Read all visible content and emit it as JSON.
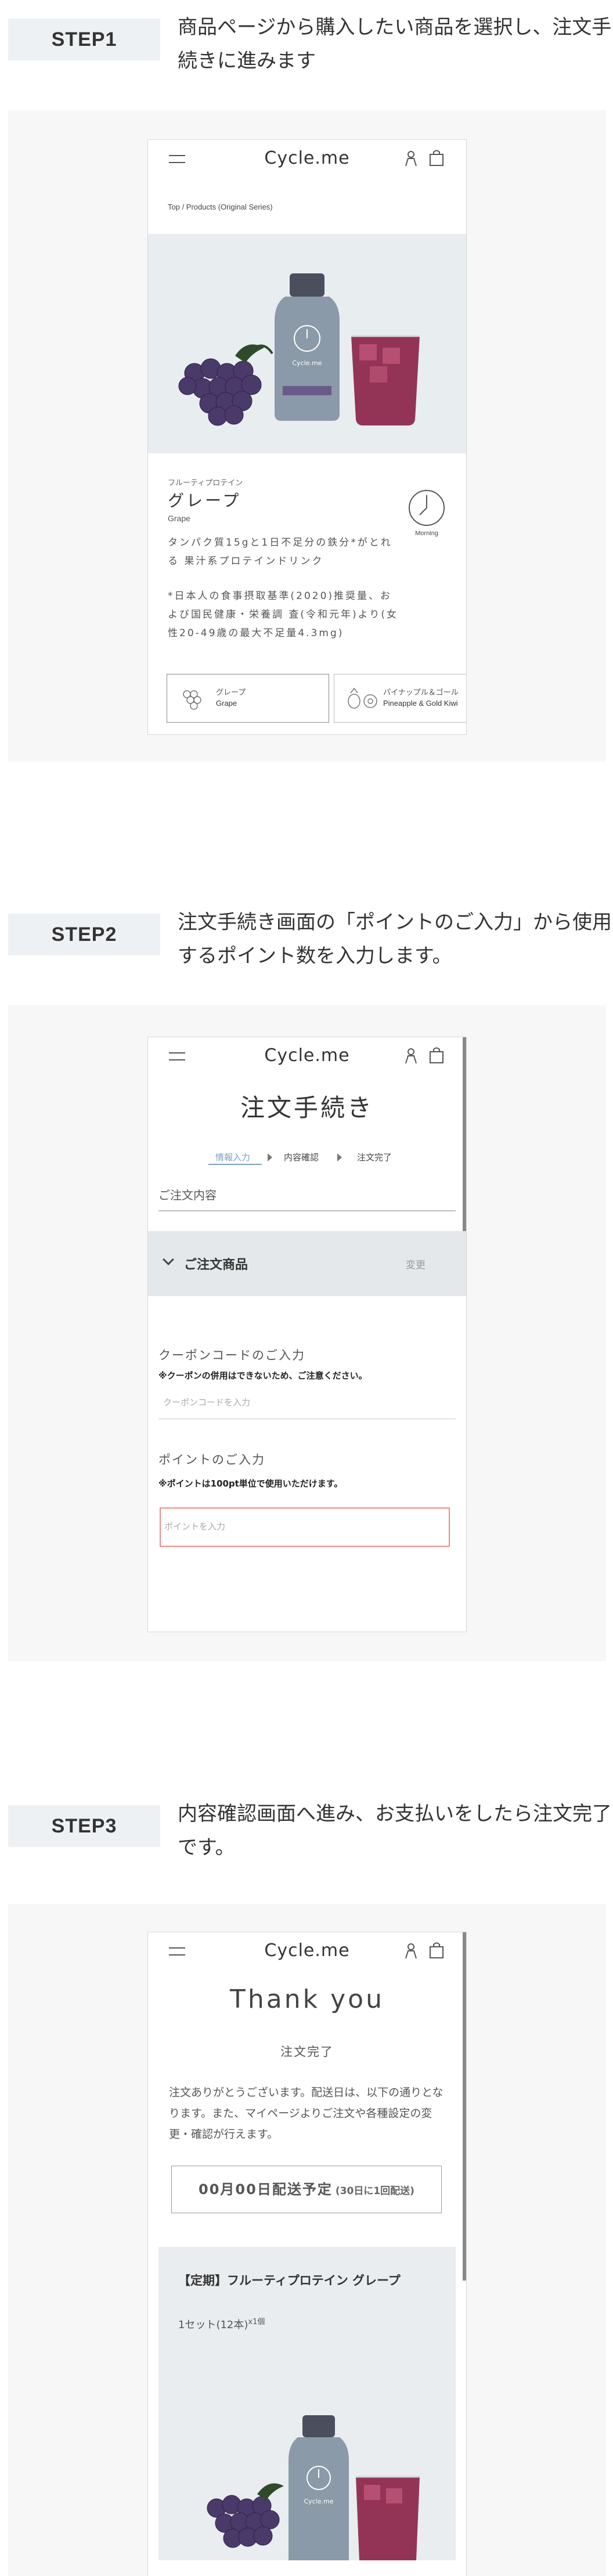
{
  "steps": [
    {
      "badge": "STEP1",
      "text": "商品ページから購入したい商品を選択し、注文手続きに進みます"
    },
    {
      "badge": "STEP2",
      "text": "注文手続き画面の「ポイントのご入力」から使用するポイント数を入力します。"
    },
    {
      "badge": "STEP3",
      "text": "内容確認画面へ進み、お支払いをしたら注文完了です。"
    }
  ],
  "header": {
    "logo": "Cycle.me",
    "icons": [
      "menu-icon",
      "user-icon",
      "bag-icon"
    ]
  },
  "step1": {
    "breadcrumb": "Top  /  Products (Original Series)",
    "bottle_logo": "Cycle.me",
    "category": "フルーティプロテイン",
    "product_name": "グレープ",
    "product_name_en": "Grape",
    "description": "タンパク質15gと1日不足分の鉄分*がとれる 果汁系プロテインドリンク",
    "note": "*日本人の食事摂取基準(2020)推奨量、および国民健康・栄養調 査(令和元年)より(女性20-49歳の最大不足量4.3mg)",
    "clock_label": "Morning",
    "variants": [
      {
        "jp": "グレープ",
        "en": "Grape",
        "selected": true
      },
      {
        "jp": "パイナップル＆ゴール",
        "en": "Pineapple & Gold Kiwi",
        "selected": false
      }
    ]
  },
  "step2": {
    "title": "注文手続き",
    "progress": [
      "情報入力",
      "内容確認",
      "注文完了"
    ],
    "section": "ご注文内容",
    "items_bar": {
      "title": "ご注文商品",
      "change": "変更"
    },
    "coupon": {
      "label": "クーポンコードのご入力",
      "warning": "※クーポンの併用はできないため、ご注意ください。",
      "placeholder": "クーポンコードを入力"
    },
    "points": {
      "label": "ポイントのご入力",
      "warning": "※ポイントは100pt単位で使用いただけます。",
      "placeholder": "ポイントを入力"
    }
  },
  "step3": {
    "title": "Thank you",
    "subtitle": "注文完了",
    "message": "注文ありがとうございます。配送日は、以下の通りとなります。また、マイページよりご注文や各種設定の変更・確認が行えます。",
    "delivery_date": "00月00日配送予定",
    "delivery_schedule": "(30日に1回配送)",
    "product_title": "【定期】フルーティプロテイン グレープ",
    "quantity": "1セット(12本)",
    "quantity_sup": "x1個"
  },
  "colors": {
    "badge_bg": "#eef1f3",
    "panel_bg": "#f7f7f7",
    "hero_bg": "#e8edf0",
    "input_error": "#f08a8a",
    "grape": "#4a3a6a",
    "juice": "#8a1f45"
  }
}
